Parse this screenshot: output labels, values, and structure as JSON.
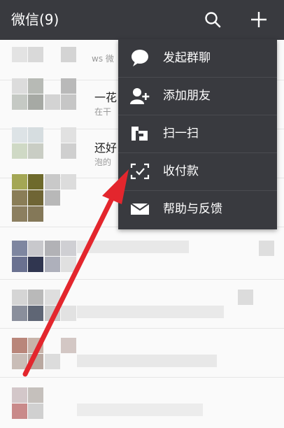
{
  "header": {
    "title": "微信(9)",
    "icons": {
      "search": "search-icon",
      "add": "plus-icon"
    }
  },
  "chat_peek": {
    "row1_sender": "ws 微",
    "row2_name": "一花",
    "row2_preview": "在干",
    "row3_name": "还好",
    "row3_preview": "泡的"
  },
  "menu": {
    "items": [
      {
        "label": "发起群聊",
        "icon": "chat-bubble-icon"
      },
      {
        "label": "添加朋友",
        "icon": "add-friend-icon"
      },
      {
        "label": "扫一扫",
        "icon": "scan-icon"
      },
      {
        "label": "收付款",
        "icon": "payment-icon"
      },
      {
        "label": "帮助与反馈",
        "icon": "mail-icon"
      }
    ]
  },
  "colors": {
    "header_bg": "#393a3f",
    "menu_bg": "#393a3f",
    "annotation_arrow": "#e3262d"
  }
}
